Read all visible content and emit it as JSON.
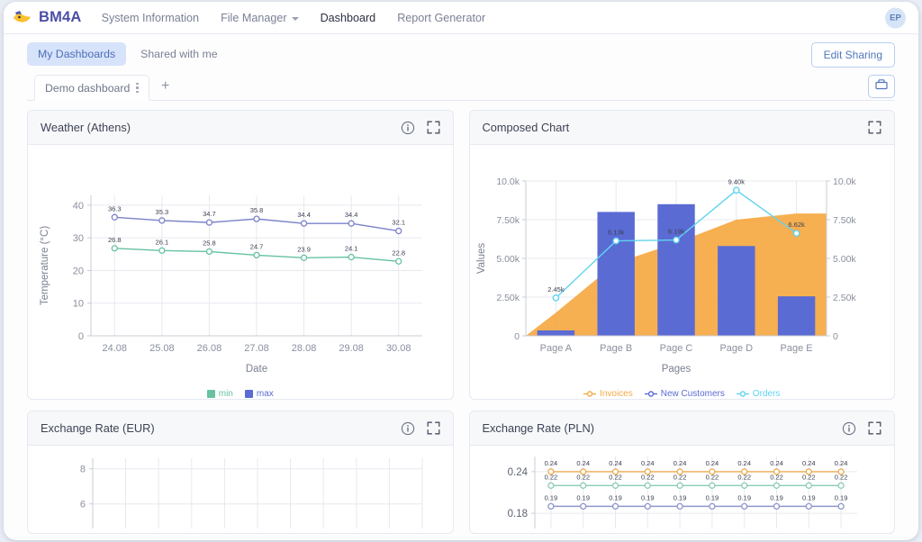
{
  "navbar": {
    "brand": "BM4A",
    "brand_icon": "bird-logo-icon",
    "links": [
      {
        "label": "System Information",
        "active": false,
        "caret": false
      },
      {
        "label": "File Manager",
        "active": false,
        "caret": true
      },
      {
        "label": "Dashboard",
        "active": true,
        "caret": false
      },
      {
        "label": "Report Generator",
        "active": false,
        "caret": false
      }
    ],
    "avatar_initials": "EP"
  },
  "dashboard_header": {
    "segments": [
      {
        "label": "My Dashboards",
        "active": true
      },
      {
        "label": "Shared with me",
        "active": false
      }
    ],
    "edit_sharing_label": "Edit Sharing",
    "archive_icon": "archive-box-icon",
    "tabs": [
      {
        "label": "Demo dashboard",
        "active": true
      }
    ],
    "add_tab_label": "+"
  },
  "cards": [
    {
      "title": "Weather (Athens)",
      "info_icon": "info-circle-icon",
      "expand_icon": "fullscreen-icon",
      "has_info": true
    },
    {
      "title": "Composed Chart",
      "expand_icon": "fullscreen-icon",
      "has_info": false
    },
    {
      "title": "Exchange Rate (EUR)",
      "info_icon": "info-circle-icon",
      "expand_icon": "fullscreen-icon",
      "has_info": true
    },
    {
      "title": "Exchange Rate (PLN)",
      "info_icon": "info-circle-icon",
      "expand_icon": "fullscreen-icon",
      "has_info": true
    }
  ],
  "colors": {
    "accent_blue": "#5b6bd4",
    "min_green": "#66c2a0",
    "max_blue": "#5b6bd4",
    "invoices_orange": "#f5ab48",
    "orders_cyan": "#62d4f0",
    "brand_purple": "#4b4fa6",
    "segment_active_bg": "#d7e3fb"
  },
  "chart_data": [
    {
      "type": "line",
      "title": "Weather (Athens)",
      "xlabel": "Date",
      "ylabel": "Temperature (°C)",
      "categories": [
        "24.08",
        "25.08",
        "26.08",
        "27.08",
        "28.08",
        "29.08",
        "30.08"
      ],
      "ylim": [
        0,
        43
      ],
      "yticks": [
        0,
        10,
        20,
        30,
        40
      ],
      "grid": true,
      "legend_position": "bottom",
      "series": [
        {
          "name": "min",
          "color": "#66c2a0",
          "values": [
            26.8,
            26.1,
            25.8,
            24.7,
            23.9,
            24.1,
            22.8
          ],
          "labels": [
            "26.8",
            "26.1",
            "25.8",
            "24.7",
            "23.9",
            "24.1",
            "22.8"
          ]
        },
        {
          "name": "max",
          "color": "#7b82c9",
          "values": [
            36.3,
            35.3,
            34.7,
            35.8,
            34.4,
            34.4,
            32.1
          ],
          "labels": [
            "36.3",
            "35.3",
            "34.7",
            "35.8",
            "34.4",
            "34.4",
            "32.1"
          ]
        }
      ]
    },
    {
      "type": "bar",
      "title": "Composed Chart",
      "xlabel": "Pages",
      "ylabel": "Values",
      "categories": [
        "Page A",
        "Page B",
        "Page C",
        "Page D",
        "Page E"
      ],
      "ylim": [
        0,
        10000
      ],
      "yticks": [
        0,
        2500,
        5000,
        7500,
        10000
      ],
      "ytick_labels": [
        "0",
        "2.50k",
        "5.00k",
        "7.50k",
        "10.0k"
      ],
      "right_axis": true,
      "grid": true,
      "legend_position": "bottom",
      "series": [
        {
          "name": "Invoices",
          "type": "area",
          "color": "#f5ab48",
          "values": [
            1500,
            4700,
            6000,
            7500,
            7900
          ]
        },
        {
          "name": "New Customers",
          "type": "bar",
          "color": "#5b6bd4",
          "values": [
            350,
            8000,
            8500,
            5800,
            2550
          ]
        },
        {
          "name": "Orders",
          "type": "line",
          "color": "#62d4f0",
          "values": [
            2450,
            6130,
            6190,
            9400,
            6620
          ],
          "labels": [
            "2.45k",
            "6.13k",
            "6.19k",
            "9.40k",
            "6.62k"
          ]
        }
      ]
    },
    {
      "type": "line",
      "title": "Exchange Rate (EUR)",
      "yticks": [
        6,
        8
      ],
      "ytick_labels": [
        "6",
        "8"
      ],
      "grid": true,
      "series": []
    },
    {
      "type": "line",
      "title": "Exchange Rate (PLN)",
      "yticks": [
        0.18,
        0.24
      ],
      "ytick_labels": [
        "0.18",
        "0.24"
      ],
      "grid": true,
      "points": 10,
      "series": [
        {
          "name": "series-orange",
          "color": "#f0a94f",
          "value": 0.24,
          "label": "0.24"
        },
        {
          "name": "series-green",
          "color": "#8ecab3",
          "value": 0.22,
          "label": "0.22"
        },
        {
          "name": "series-blue",
          "color": "#8f97cc",
          "value": 0.19,
          "label": "0.19"
        }
      ]
    }
  ]
}
